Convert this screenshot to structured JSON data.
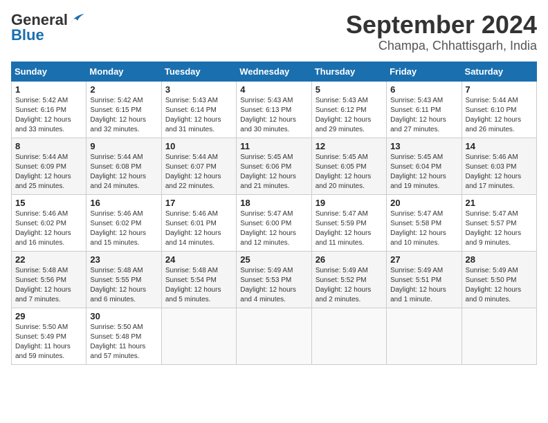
{
  "header": {
    "logo_general": "General",
    "logo_blue": "Blue",
    "main_title": "September 2024",
    "sub_title": "Champa, Chhattisgarh, India"
  },
  "calendar": {
    "days_of_week": [
      "Sunday",
      "Monday",
      "Tuesday",
      "Wednesday",
      "Thursday",
      "Friday",
      "Saturday"
    ],
    "weeks": [
      [
        {
          "day": "",
          "info": ""
        },
        {
          "day": "2",
          "info": "Sunrise: 5:42 AM\nSunset: 6:15 PM\nDaylight: 12 hours\nand 32 minutes."
        },
        {
          "day": "3",
          "info": "Sunrise: 5:43 AM\nSunset: 6:14 PM\nDaylight: 12 hours\nand 31 minutes."
        },
        {
          "day": "4",
          "info": "Sunrise: 5:43 AM\nSunset: 6:13 PM\nDaylight: 12 hours\nand 30 minutes."
        },
        {
          "day": "5",
          "info": "Sunrise: 5:43 AM\nSunset: 6:12 PM\nDaylight: 12 hours\nand 29 minutes."
        },
        {
          "day": "6",
          "info": "Sunrise: 5:43 AM\nSunset: 6:11 PM\nDaylight: 12 hours\nand 27 minutes."
        },
        {
          "day": "7",
          "info": "Sunrise: 5:44 AM\nSunset: 6:10 PM\nDaylight: 12 hours\nand 26 minutes."
        }
      ],
      [
        {
          "day": "1",
          "info": "Sunrise: 5:42 AM\nSunset: 6:16 PM\nDaylight: 12 hours\nand 33 minutes."
        },
        {
          "day": "",
          "info": ""
        },
        {
          "day": "",
          "info": ""
        },
        {
          "day": "",
          "info": ""
        },
        {
          "day": "",
          "info": ""
        },
        {
          "day": "",
          "info": ""
        },
        {
          "day": "",
          "info": ""
        }
      ],
      [
        {
          "day": "8",
          "info": "Sunrise: 5:44 AM\nSunset: 6:09 PM\nDaylight: 12 hours\nand 25 minutes."
        },
        {
          "day": "9",
          "info": "Sunrise: 5:44 AM\nSunset: 6:08 PM\nDaylight: 12 hours\nand 24 minutes."
        },
        {
          "day": "10",
          "info": "Sunrise: 5:44 AM\nSunset: 6:07 PM\nDaylight: 12 hours\nand 22 minutes."
        },
        {
          "day": "11",
          "info": "Sunrise: 5:45 AM\nSunset: 6:06 PM\nDaylight: 12 hours\nand 21 minutes."
        },
        {
          "day": "12",
          "info": "Sunrise: 5:45 AM\nSunset: 6:05 PM\nDaylight: 12 hours\nand 20 minutes."
        },
        {
          "day": "13",
          "info": "Sunrise: 5:45 AM\nSunset: 6:04 PM\nDaylight: 12 hours\nand 19 minutes."
        },
        {
          "day": "14",
          "info": "Sunrise: 5:46 AM\nSunset: 6:03 PM\nDaylight: 12 hours\nand 17 minutes."
        }
      ],
      [
        {
          "day": "15",
          "info": "Sunrise: 5:46 AM\nSunset: 6:02 PM\nDaylight: 12 hours\nand 16 minutes."
        },
        {
          "day": "16",
          "info": "Sunrise: 5:46 AM\nSunset: 6:02 PM\nDaylight: 12 hours\nand 15 minutes."
        },
        {
          "day": "17",
          "info": "Sunrise: 5:46 AM\nSunset: 6:01 PM\nDaylight: 12 hours\nand 14 minutes."
        },
        {
          "day": "18",
          "info": "Sunrise: 5:47 AM\nSunset: 6:00 PM\nDaylight: 12 hours\nand 12 minutes."
        },
        {
          "day": "19",
          "info": "Sunrise: 5:47 AM\nSunset: 5:59 PM\nDaylight: 12 hours\nand 11 minutes."
        },
        {
          "day": "20",
          "info": "Sunrise: 5:47 AM\nSunset: 5:58 PM\nDaylight: 12 hours\nand 10 minutes."
        },
        {
          "day": "21",
          "info": "Sunrise: 5:47 AM\nSunset: 5:57 PM\nDaylight: 12 hours\nand 9 minutes."
        }
      ],
      [
        {
          "day": "22",
          "info": "Sunrise: 5:48 AM\nSunset: 5:56 PM\nDaylight: 12 hours\nand 7 minutes."
        },
        {
          "day": "23",
          "info": "Sunrise: 5:48 AM\nSunset: 5:55 PM\nDaylight: 12 hours\nand 6 minutes."
        },
        {
          "day": "24",
          "info": "Sunrise: 5:48 AM\nSunset: 5:54 PM\nDaylight: 12 hours\nand 5 minutes."
        },
        {
          "day": "25",
          "info": "Sunrise: 5:49 AM\nSunset: 5:53 PM\nDaylight: 12 hours\nand 4 minutes."
        },
        {
          "day": "26",
          "info": "Sunrise: 5:49 AM\nSunset: 5:52 PM\nDaylight: 12 hours\nand 2 minutes."
        },
        {
          "day": "27",
          "info": "Sunrise: 5:49 AM\nSunset: 5:51 PM\nDaylight: 12 hours\nand 1 minute."
        },
        {
          "day": "28",
          "info": "Sunrise: 5:49 AM\nSunset: 5:50 PM\nDaylight: 12 hours\nand 0 minutes."
        }
      ],
      [
        {
          "day": "29",
          "info": "Sunrise: 5:50 AM\nSunset: 5:49 PM\nDaylight: 11 hours\nand 59 minutes."
        },
        {
          "day": "30",
          "info": "Sunrise: 5:50 AM\nSunset: 5:48 PM\nDaylight: 11 hours\nand 57 minutes."
        },
        {
          "day": "",
          "info": ""
        },
        {
          "day": "",
          "info": ""
        },
        {
          "day": "",
          "info": ""
        },
        {
          "day": "",
          "info": ""
        },
        {
          "day": "",
          "info": ""
        }
      ]
    ]
  }
}
